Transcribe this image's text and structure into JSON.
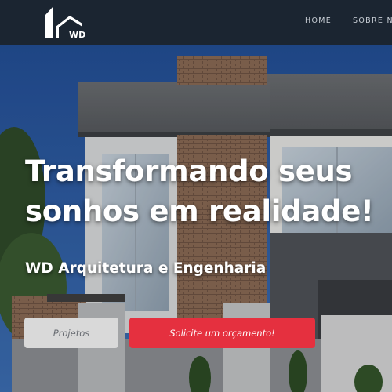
{
  "navbar": {
    "logo_text": "WD",
    "links": [
      {
        "label": "HOME"
      },
      {
        "label": "SOBRE NÓS"
      }
    ]
  },
  "hero": {
    "title_line1": "Transformando seus",
    "title_line2": "sonhos em realidade!",
    "subtitle": "WD Arquitetura e Engenharia",
    "buttons": {
      "projetos": "Projetos",
      "orcamento": "Solicite um orçamento!"
    }
  },
  "colors": {
    "navbar_bg": "#1b2531",
    "primary_button": "#e5303f",
    "secondary_button": "#d9d9d9",
    "sky": "#2a5aa3"
  }
}
